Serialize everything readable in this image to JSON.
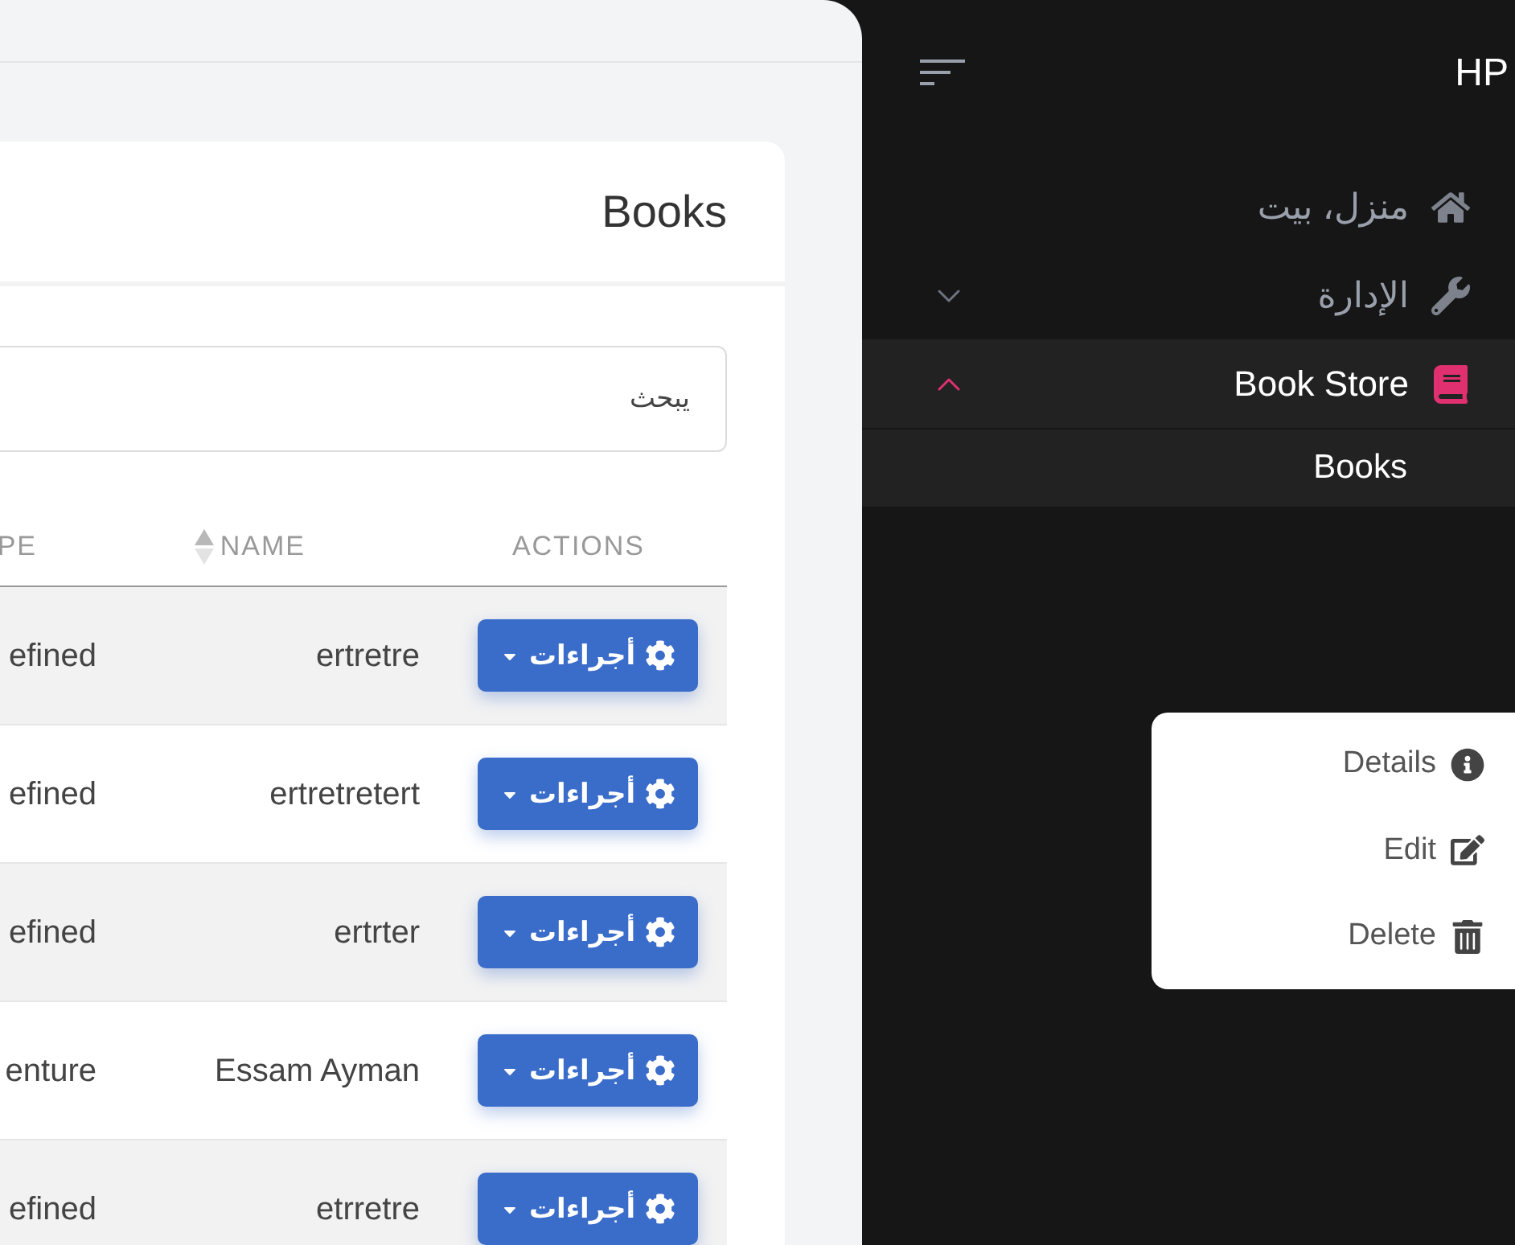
{
  "card": {
    "title": "Books"
  },
  "search": {
    "placeholder": "يبحث"
  },
  "table": {
    "columns": [
      {
        "label": "ACTIONS",
        "sortable": false
      },
      {
        "label": "NAME",
        "sortable": true
      },
      {
        "label": "PE"
      }
    ],
    "rows": [
      {
        "type": "efined",
        "name": "ertretre",
        "action": "أجراءات"
      },
      {
        "type": "efined",
        "name": "ertretretert",
        "action": "أجراءات"
      },
      {
        "type": "efined",
        "name": "ertrter",
        "action": "أجراءات"
      },
      {
        "type": "enture",
        "name": "Essam Ayman",
        "action": "أجراءات"
      },
      {
        "type": "efined",
        "name": "etrretre",
        "action": "أجراءات"
      }
    ]
  },
  "sidebar": {
    "brand": "HP",
    "items": [
      {
        "label": "منزل، بيت",
        "kind": "home",
        "selected": false
      },
      {
        "label": "الإدارة",
        "kind": "wrench",
        "selected": false,
        "expanded": false
      },
      {
        "label": "Book Store",
        "kind": "book",
        "selected": true,
        "expanded": true,
        "children": [
          {
            "label": "Books",
            "selected": true
          }
        ]
      }
    ]
  },
  "menu": {
    "items": [
      {
        "label": "Details",
        "kind": "info"
      },
      {
        "label": "Edit",
        "kind": "edit"
      },
      {
        "label": "Delete",
        "kind": "delete"
      }
    ]
  }
}
